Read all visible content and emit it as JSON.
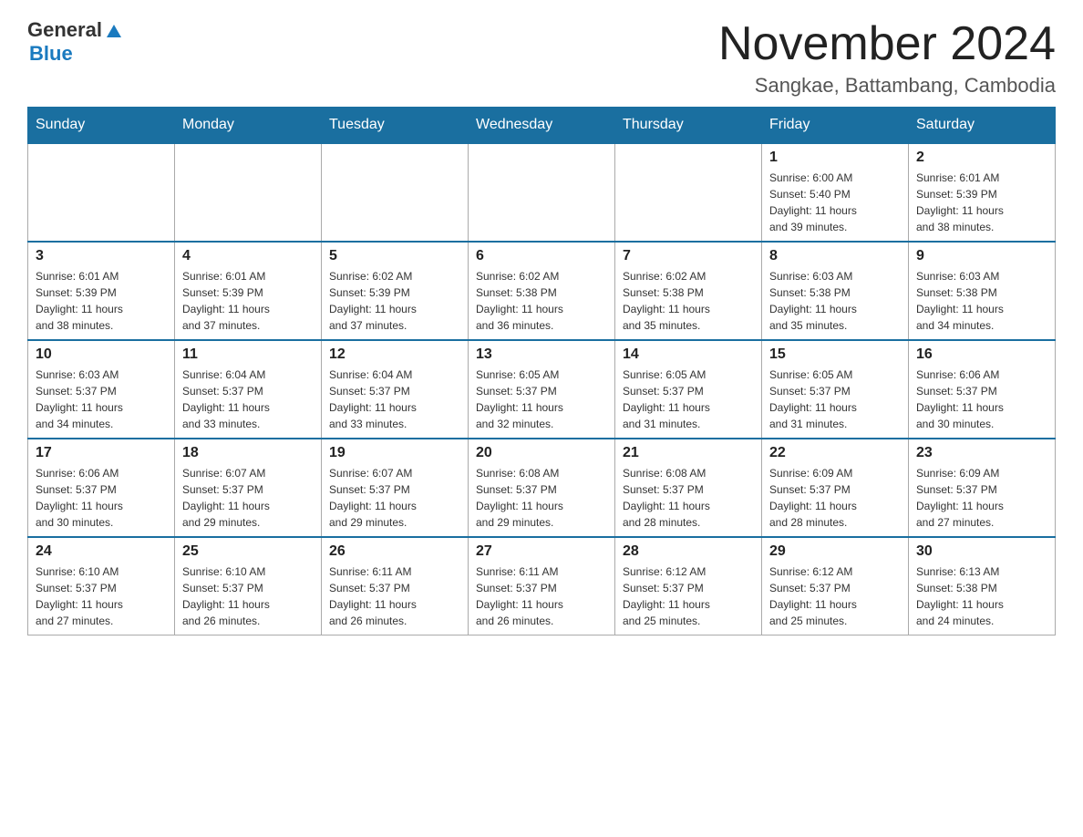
{
  "header": {
    "logo": {
      "general": "General",
      "blue": "Blue"
    },
    "title": "November 2024",
    "subtitle": "Sangkae, Battambang, Cambodia"
  },
  "weekdays": [
    "Sunday",
    "Monday",
    "Tuesday",
    "Wednesday",
    "Thursday",
    "Friday",
    "Saturday"
  ],
  "weeks": [
    [
      {
        "day": "",
        "info": ""
      },
      {
        "day": "",
        "info": ""
      },
      {
        "day": "",
        "info": ""
      },
      {
        "day": "",
        "info": ""
      },
      {
        "day": "",
        "info": ""
      },
      {
        "day": "1",
        "info": "Sunrise: 6:00 AM\nSunset: 5:40 PM\nDaylight: 11 hours\nand 39 minutes."
      },
      {
        "day": "2",
        "info": "Sunrise: 6:01 AM\nSunset: 5:39 PM\nDaylight: 11 hours\nand 38 minutes."
      }
    ],
    [
      {
        "day": "3",
        "info": "Sunrise: 6:01 AM\nSunset: 5:39 PM\nDaylight: 11 hours\nand 38 minutes."
      },
      {
        "day": "4",
        "info": "Sunrise: 6:01 AM\nSunset: 5:39 PM\nDaylight: 11 hours\nand 37 minutes."
      },
      {
        "day": "5",
        "info": "Sunrise: 6:02 AM\nSunset: 5:39 PM\nDaylight: 11 hours\nand 37 minutes."
      },
      {
        "day": "6",
        "info": "Sunrise: 6:02 AM\nSunset: 5:38 PM\nDaylight: 11 hours\nand 36 minutes."
      },
      {
        "day": "7",
        "info": "Sunrise: 6:02 AM\nSunset: 5:38 PM\nDaylight: 11 hours\nand 35 minutes."
      },
      {
        "day": "8",
        "info": "Sunrise: 6:03 AM\nSunset: 5:38 PM\nDaylight: 11 hours\nand 35 minutes."
      },
      {
        "day": "9",
        "info": "Sunrise: 6:03 AM\nSunset: 5:38 PM\nDaylight: 11 hours\nand 34 minutes."
      }
    ],
    [
      {
        "day": "10",
        "info": "Sunrise: 6:03 AM\nSunset: 5:37 PM\nDaylight: 11 hours\nand 34 minutes."
      },
      {
        "day": "11",
        "info": "Sunrise: 6:04 AM\nSunset: 5:37 PM\nDaylight: 11 hours\nand 33 minutes."
      },
      {
        "day": "12",
        "info": "Sunrise: 6:04 AM\nSunset: 5:37 PM\nDaylight: 11 hours\nand 33 minutes."
      },
      {
        "day": "13",
        "info": "Sunrise: 6:05 AM\nSunset: 5:37 PM\nDaylight: 11 hours\nand 32 minutes."
      },
      {
        "day": "14",
        "info": "Sunrise: 6:05 AM\nSunset: 5:37 PM\nDaylight: 11 hours\nand 31 minutes."
      },
      {
        "day": "15",
        "info": "Sunrise: 6:05 AM\nSunset: 5:37 PM\nDaylight: 11 hours\nand 31 minutes."
      },
      {
        "day": "16",
        "info": "Sunrise: 6:06 AM\nSunset: 5:37 PM\nDaylight: 11 hours\nand 30 minutes."
      }
    ],
    [
      {
        "day": "17",
        "info": "Sunrise: 6:06 AM\nSunset: 5:37 PM\nDaylight: 11 hours\nand 30 minutes."
      },
      {
        "day": "18",
        "info": "Sunrise: 6:07 AM\nSunset: 5:37 PM\nDaylight: 11 hours\nand 29 minutes."
      },
      {
        "day": "19",
        "info": "Sunrise: 6:07 AM\nSunset: 5:37 PM\nDaylight: 11 hours\nand 29 minutes."
      },
      {
        "day": "20",
        "info": "Sunrise: 6:08 AM\nSunset: 5:37 PM\nDaylight: 11 hours\nand 29 minutes."
      },
      {
        "day": "21",
        "info": "Sunrise: 6:08 AM\nSunset: 5:37 PM\nDaylight: 11 hours\nand 28 minutes."
      },
      {
        "day": "22",
        "info": "Sunrise: 6:09 AM\nSunset: 5:37 PM\nDaylight: 11 hours\nand 28 minutes."
      },
      {
        "day": "23",
        "info": "Sunrise: 6:09 AM\nSunset: 5:37 PM\nDaylight: 11 hours\nand 27 minutes."
      }
    ],
    [
      {
        "day": "24",
        "info": "Sunrise: 6:10 AM\nSunset: 5:37 PM\nDaylight: 11 hours\nand 27 minutes."
      },
      {
        "day": "25",
        "info": "Sunrise: 6:10 AM\nSunset: 5:37 PM\nDaylight: 11 hours\nand 26 minutes."
      },
      {
        "day": "26",
        "info": "Sunrise: 6:11 AM\nSunset: 5:37 PM\nDaylight: 11 hours\nand 26 minutes."
      },
      {
        "day": "27",
        "info": "Sunrise: 6:11 AM\nSunset: 5:37 PM\nDaylight: 11 hours\nand 26 minutes."
      },
      {
        "day": "28",
        "info": "Sunrise: 6:12 AM\nSunset: 5:37 PM\nDaylight: 11 hours\nand 25 minutes."
      },
      {
        "day": "29",
        "info": "Sunrise: 6:12 AM\nSunset: 5:37 PM\nDaylight: 11 hours\nand 25 minutes."
      },
      {
        "day": "30",
        "info": "Sunrise: 6:13 AM\nSunset: 5:38 PM\nDaylight: 11 hours\nand 24 minutes."
      }
    ]
  ]
}
